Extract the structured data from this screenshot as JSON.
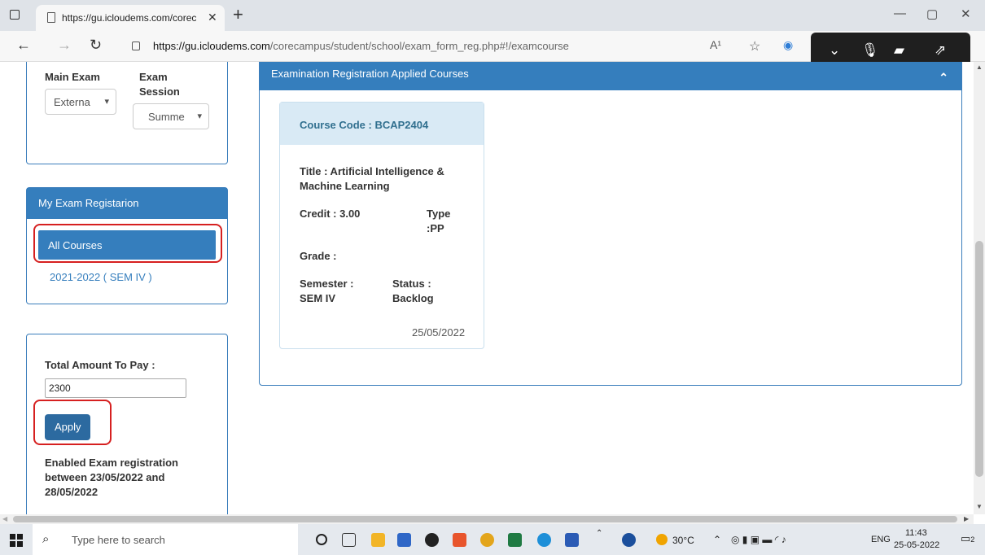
{
  "browser": {
    "tab_title": "https://gu.icloudems.com/corec",
    "url_host": "https://gu.icloudems.com",
    "url_path": "/corecampus/student/school/exam_form_reg.php#!/examcourse",
    "read_aloud": "A¹"
  },
  "filters": {
    "main_exam_label": "Main Exam",
    "main_exam_value": "Externa",
    "exam_label": "Exam",
    "session_label": "Session",
    "session_value": "Summe"
  },
  "registration": {
    "heading": "My Exam Registarion",
    "all_courses": "All Courses",
    "semester_link": "2021-2022 ( SEM IV )"
  },
  "payment": {
    "total_label": "Total Amount To Pay :",
    "amount": "2300",
    "apply_label": "Apply",
    "window_line1": "Enabled Exam registration",
    "window_line2": "between 23/05/2022 and",
    "window_line3": "28/05/2022"
  },
  "applied": {
    "heading": "Examination Registration Applied Courses",
    "course_code": "Course Code : BCAP2404",
    "title_line1": "Title : Artificial Intelligence &",
    "title_line2": "Machine Learning",
    "credit": "Credit : 3.00",
    "type_line1": "Type",
    "type_line2": ":PP",
    "grade": "Grade :",
    "semester_line1": "Semester :",
    "semester_line2": "SEM IV",
    "status_line1": "Status :",
    "status_line2": "Backlog",
    "date": "25/05/2022"
  },
  "taskbar": {
    "search_placeholder": "Type here to search",
    "weather": "30°C",
    "language": "ENG",
    "time": "11:43",
    "date": "25-05-2022",
    "notifications": "2"
  }
}
